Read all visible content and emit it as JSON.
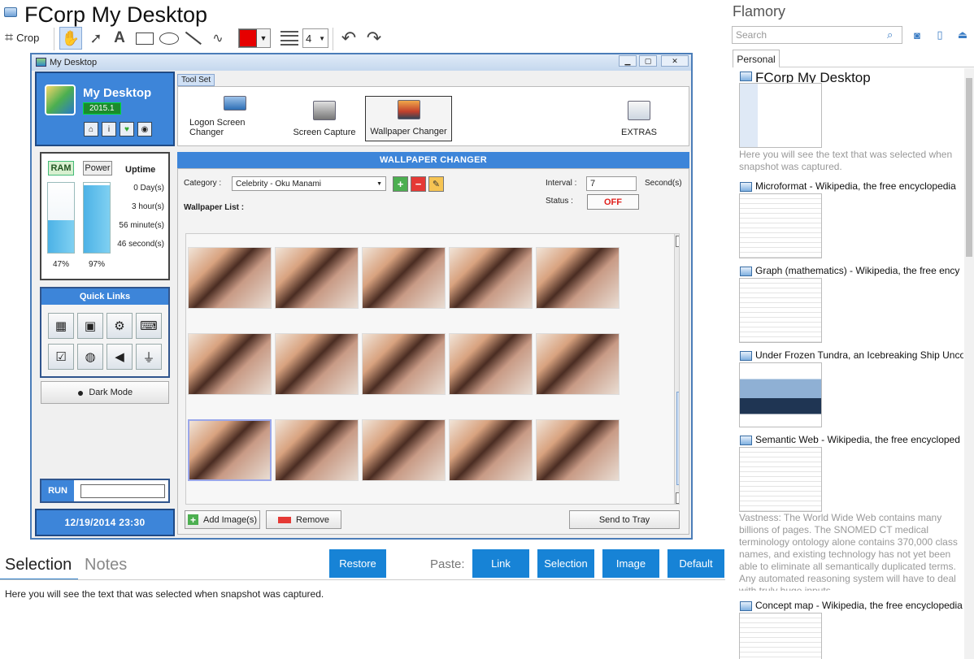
{
  "app": {
    "title": "FCorp My Desktop",
    "crop_label": "Crop"
  },
  "toolbar": {
    "color": "#e60000",
    "width_value": "4",
    "tools": [
      "hand-icon",
      "arrow-icon",
      "text-icon",
      "rectangle-icon",
      "ellipse-icon",
      "line-icon",
      "freehand-icon"
    ],
    "text_tool_glyph": "A"
  },
  "snapshot": {
    "window_title": "My Desktop",
    "app_name": "My Desktop",
    "version": "2015.1",
    "ram_label": "RAM",
    "power_label": "Power",
    "uptime_label": "Uptime",
    "uptime": [
      "0 Day(s)",
      "3 hour(s)",
      "56 minute(s)",
      "46 second(s)"
    ],
    "ram_pct": "47%",
    "power_pct": "97%",
    "ram_level": 0.47,
    "power_level": 0.97,
    "quick_links_label": "Quick Links",
    "dark_mode_label": "Dark Mode",
    "run_label": "RUN",
    "clock": "12/19/2014  23:30",
    "toolset_tab": "Tool Set",
    "tools": [
      "Logon Screen Changer",
      "Screen Capture",
      "Wallpaper Changer",
      "EXTRAS"
    ],
    "wc_header": "WALLPAPER CHANGER",
    "category_label": "Category :",
    "category_value": "Celebrity - Oku Manami",
    "interval_label": "Interval :",
    "interval_value": "7",
    "interval_unit": "Second(s)",
    "status_label": "Status :",
    "status_value": "OFF",
    "wallpaper_list_label": "Wallpaper List :",
    "add_images": "Add Image(s)",
    "remove": "Remove",
    "send_to_tray": "Send to Tray"
  },
  "bottom": {
    "tabs": [
      "Selection",
      "Notes"
    ],
    "restore": "Restore",
    "paste_label": "Paste:",
    "paste_buttons": [
      "Link",
      "Selection",
      "Image",
      "Default"
    ],
    "selection_text": "Here you will see the text that was selected when snapshot was captured."
  },
  "sidebar": {
    "title": "Flamory",
    "search_placeholder": "Search",
    "tab": "Personal",
    "items": [
      {
        "title": "FCorp My Desktop",
        "desc": "Here you will see the text that was selected when snapshot was captured."
      },
      {
        "title": "Microformat - Wikipedia, the free encyclopedia",
        "desc": ""
      },
      {
        "title": "Graph (mathematics) - Wikipedia, the free ency",
        "desc": ""
      },
      {
        "title": "Under Frozen Tundra, an Icebreaking Ship Unco",
        "desc": ""
      },
      {
        "title": "Semantic Web - Wikipedia, the free encycloped",
        "desc": "Vastness: The World Wide Web contains many billions of pages. The SNOMED CT medical terminology ontology alone contains 370,000 class names, and existing technology has not yet been able to eliminate all semantically duplicated terms. Any automated reasoning system will have to deal with truly huge inputs."
      },
      {
        "title": "Concept map - Wikipedia, the free encyclopedia",
        "desc": ""
      }
    ]
  }
}
